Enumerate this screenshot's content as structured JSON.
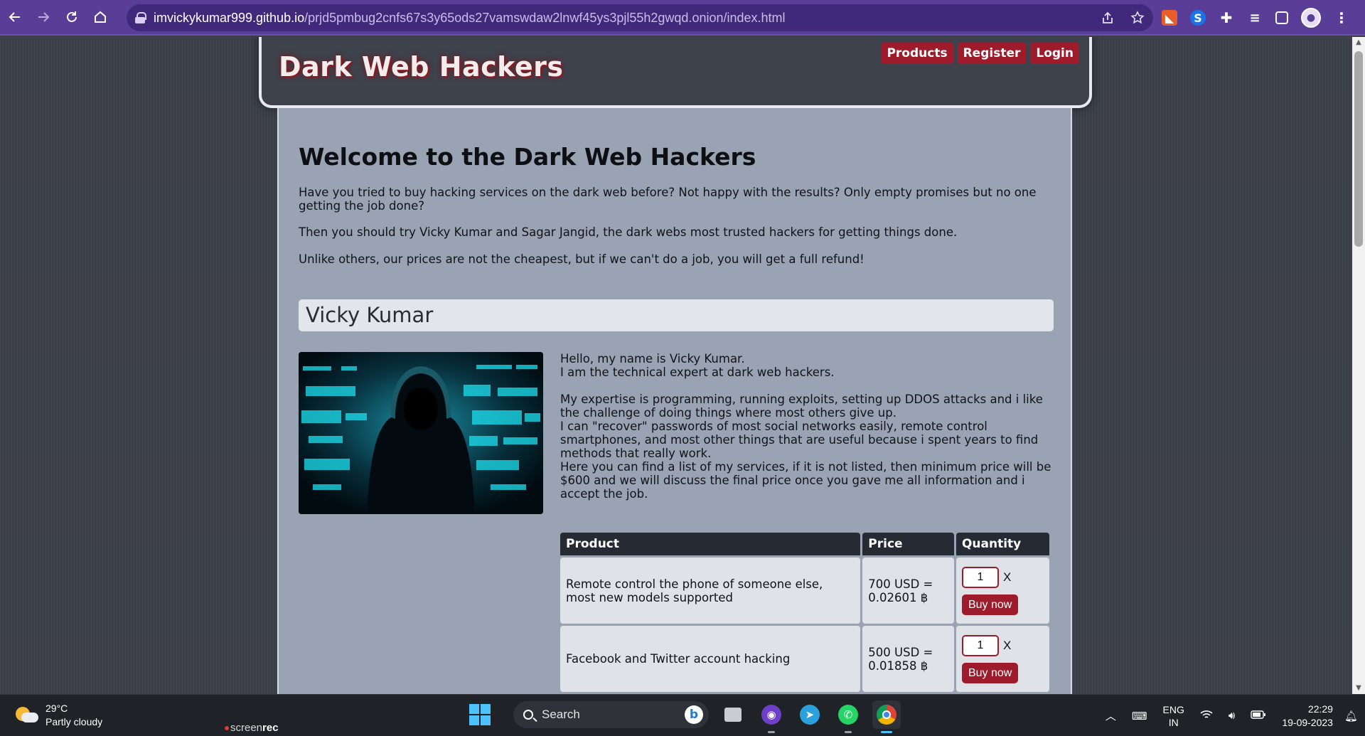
{
  "browser": {
    "url_host": "imvickykumar999.github.io",
    "url_path": "/prjd5pmbug2cnfs67s3y65ods27vamswdaw2lnwf45ys3pjl55h2gwqd.onion/index.html"
  },
  "site": {
    "title": "Dark Web Hackers",
    "nav": [
      "Products",
      "Register",
      "Login"
    ]
  },
  "intro": {
    "heading": "Welcome to the Dark Web Hackers",
    "p1": "Have you tried to buy hacking services on the dark web before? Not happy with the results? Only empty promises but no one getting the job done?",
    "p2": "Then you should try Vicky Kumar and Sagar Jangid, the dark webs most trusted hackers for getting things done.",
    "p3": "Unlike others, our prices are not the cheapest, but if we can't do a job, you will get a full refund!"
  },
  "profile": {
    "name": "Vicky Kumar",
    "bio": [
      "Hello, my name is Vicky Kumar.",
      "I am the technical expert at dark web hackers.",
      "",
      "My expertise is programming, running exploits, setting up DDOS attacks and i like the challenge of doing things where most others give up.",
      "I can \"recover\" passwords of most social networks easily, remote control smartphones, and most other things that are useful because i spent years to find methods that really work.",
      "Here you can find a list of my services, if it is not listed, then minimum price will be $600 and we will discuss the final price once you gave me all information and i accept the job."
    ]
  },
  "table": {
    "headers": [
      "Product",
      "Price",
      "Quantity"
    ],
    "rows": [
      {
        "product": "Remote control the phone of someone else, most new models supported",
        "price_usd": "700 USD =",
        "price_btc": "0.02601 ฿",
        "qty": "1",
        "x": "X",
        "buy": "Buy now"
      },
      {
        "product": "Facebook and Twitter account hacking",
        "price_usd": "500 USD =",
        "price_btc": "0.01858 ฿",
        "qty": "1",
        "x": "X",
        "buy": "Buy now"
      }
    ]
  },
  "taskbar": {
    "temp": "29°C",
    "weather": "Partly cloudy",
    "screenrec_a": "screen",
    "screenrec_b": "rec",
    "search": "Search",
    "lang1": "ENG",
    "lang2": "IN",
    "time": "22:29",
    "date": "19-09-2023"
  }
}
